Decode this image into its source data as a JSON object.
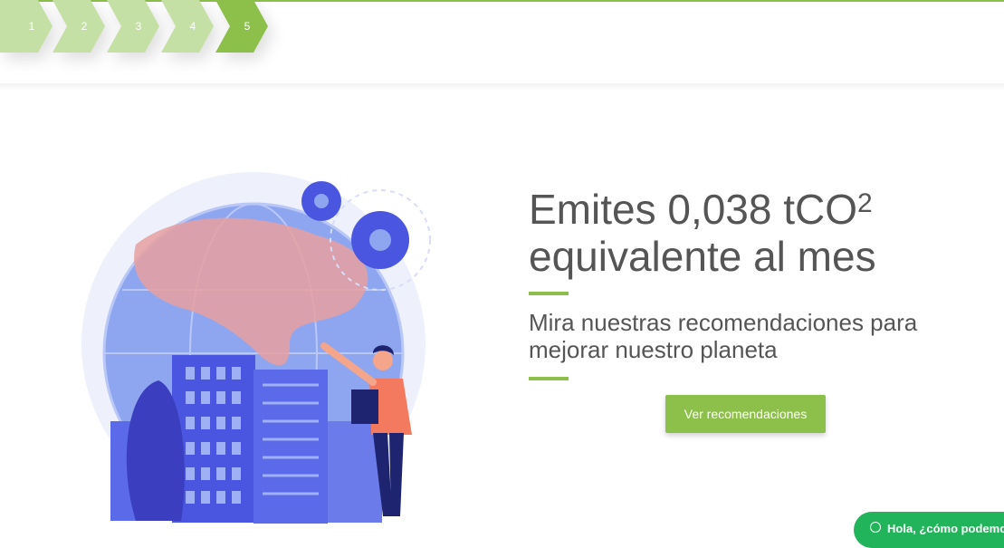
{
  "stepper": {
    "steps": [
      {
        "label": "1",
        "active": false
      },
      {
        "label": "2",
        "active": false
      },
      {
        "label": "3",
        "active": false
      },
      {
        "label": "4",
        "active": false
      },
      {
        "label": "5",
        "active": true
      }
    ]
  },
  "result": {
    "headline_line1_prefix": "Emites 0,038 tCO",
    "headline_superscript": "2",
    "headline_line2": "equivalente al mes",
    "subtitle": "Mira nuestras recomendaciones para mejorar nuestro planeta",
    "cta_label": "Ver recomendaciones"
  },
  "chat_widget": {
    "label": "Hola, ¿cómo podemos"
  },
  "illustration": {
    "name": "globe-city-person-illustration"
  },
  "colors": {
    "accent": "#8dc04a",
    "step_inactive": "#c5e0a5",
    "step_active": "#8dc04a",
    "text": "#555555",
    "chat": "#22b45a"
  }
}
